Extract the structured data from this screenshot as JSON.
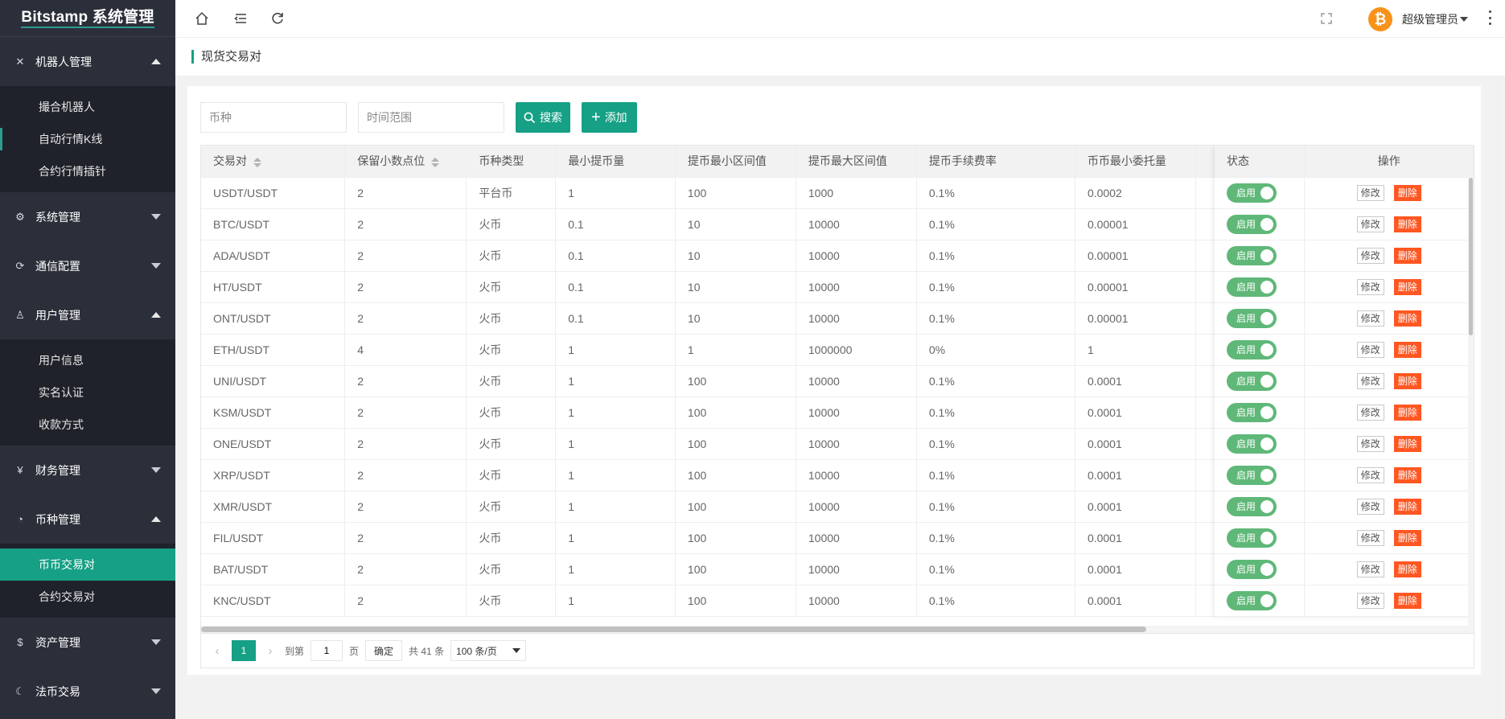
{
  "app": {
    "title": "Bitstamp 系统管理"
  },
  "sidebar": {
    "groups": [
      {
        "label": "机器人管理",
        "icon": "robot-icon",
        "expanded": true,
        "items": [
          "撮合机器人",
          "自动行情K线",
          "合约行情插针"
        ]
      },
      {
        "label": "系统管理",
        "icon": "gear-icon",
        "expanded": false,
        "items": []
      },
      {
        "label": "通信配置",
        "icon": "comm-icon",
        "expanded": false,
        "items": []
      },
      {
        "label": "用户管理",
        "icon": "user-icon",
        "expanded": true,
        "items": [
          "用户信息",
          "实名认证",
          "收款方式"
        ]
      },
      {
        "label": "财务管理",
        "icon": "yen-icon",
        "expanded": false,
        "items": []
      },
      {
        "label": "币种管理",
        "icon": "coin-icon",
        "expanded": true,
        "items": [
          "币币交易对",
          "合约交易对"
        ]
      },
      {
        "label": "资产管理",
        "icon": "dollar-icon",
        "expanded": false,
        "items": []
      },
      {
        "label": "法币交易",
        "icon": "fiat-icon",
        "expanded": false,
        "items": []
      }
    ],
    "active_item": "币币交易对"
  },
  "header": {
    "user_name": "超级管理员",
    "avatar_icon": "bitcoin-icon"
  },
  "page": {
    "title": "现货交易对"
  },
  "search": {
    "coin_placeholder": "币种",
    "time_placeholder": "时间范围",
    "search_label": "搜索",
    "add_label": "添加"
  },
  "table": {
    "columns": [
      "交易对",
      "保留小数点位",
      "币种类型",
      "最小提币量",
      "提币最小区间值",
      "提币最大区间值",
      "提币手续费率",
      "币币最小委托量"
    ],
    "fixed_columns": [
      "状态",
      "操作"
    ],
    "status_label": "启用",
    "edit_label": "修改",
    "delete_label": "删除",
    "rows": [
      [
        "USDT/USDT",
        "2",
        "平台币",
        "1",
        "100",
        "1000",
        "0.1%",
        "0.0002"
      ],
      [
        "BTC/USDT",
        "2",
        "火币",
        "0.1",
        "10",
        "10000",
        "0.1%",
        "0.00001"
      ],
      [
        "ADA/USDT",
        "2",
        "火币",
        "0.1",
        "10",
        "10000",
        "0.1%",
        "0.00001"
      ],
      [
        "HT/USDT",
        "2",
        "火币",
        "0.1",
        "10",
        "10000",
        "0.1%",
        "0.00001"
      ],
      [
        "ONT/USDT",
        "2",
        "火币",
        "0.1",
        "10",
        "10000",
        "0.1%",
        "0.00001"
      ],
      [
        "ETH/USDT",
        "4",
        "火币",
        "1",
        "1",
        "1000000",
        "0%",
        "1"
      ],
      [
        "UNI/USDT",
        "2",
        "火币",
        "1",
        "100",
        "10000",
        "0.1%",
        "0.0001"
      ],
      [
        "KSM/USDT",
        "2",
        "火币",
        "1",
        "100",
        "10000",
        "0.1%",
        "0.0001"
      ],
      [
        "ONE/USDT",
        "2",
        "火币",
        "1",
        "100",
        "10000",
        "0.1%",
        "0.0001"
      ],
      [
        "XRP/USDT",
        "2",
        "火币",
        "1",
        "100",
        "10000",
        "0.1%",
        "0.0001"
      ],
      [
        "XMR/USDT",
        "2",
        "火币",
        "1",
        "100",
        "10000",
        "0.1%",
        "0.0001"
      ],
      [
        "FIL/USDT",
        "2",
        "火币",
        "1",
        "100",
        "10000",
        "0.1%",
        "0.0001"
      ],
      [
        "BAT/USDT",
        "2",
        "火币",
        "1",
        "100",
        "10000",
        "0.1%",
        "0.0001"
      ],
      [
        "KNC/USDT",
        "2",
        "火币",
        "1",
        "100",
        "10000",
        "0.1%",
        "0.0001"
      ]
    ]
  },
  "pager": {
    "current_page": "1",
    "goto_label": "到第",
    "page_input": "1",
    "page_unit": "页",
    "confirm_label": "确定",
    "total_text": "共 41 条",
    "page_size": "100 条/页"
  },
  "colors": {
    "accent": "#16a085",
    "sidebar": "#2b2f3a",
    "danger": "#ff5722",
    "toggle": "#5fb878"
  }
}
